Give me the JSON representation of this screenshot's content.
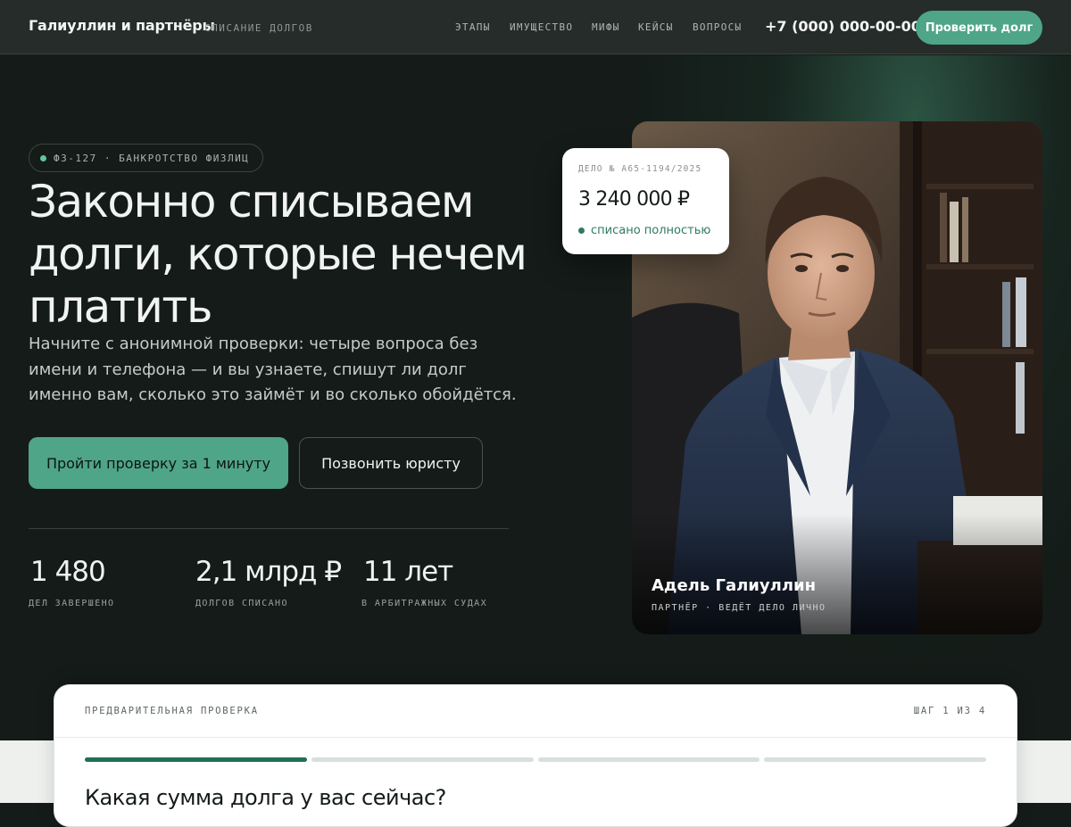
{
  "header": {
    "brand": "Галиуллин и партнёры",
    "tagline": "СПИСАНИЕ ДОЛГОВ",
    "nav": [
      "ЭТАПЫ",
      "ИМУЩЕСТВО",
      "МИФЫ",
      "КЕЙСЫ",
      "ВОПРОСЫ"
    ],
    "phone": "+7 (000) 000-00-00",
    "cta": "Проверить долг"
  },
  "hero": {
    "badge": "ФЗ-127 · БАНКРОТСТВО ФИЗЛИЦ",
    "title": "Законно списываем долги, которые нечем платить",
    "subtitle": "Начните с анонимной проверки: четыре вопроса без имени и телефона — и вы узнаете, спишут ли долг именно вам, сколько это займёт и во сколько обойдётся.",
    "primary_button": "Пройти проверку за 1 минуту",
    "secondary_button": "Позвонить юристу",
    "stats": [
      {
        "value": "1 480",
        "label": "ДЕЛ ЗАВЕРШЕНО"
      },
      {
        "value": "2,1 млрд ₽",
        "label": "ДОЛГОВ СПИСАНО"
      },
      {
        "value": "11 лет",
        "label": "В АРБИТРАЖНЫХ СУДАХ"
      }
    ]
  },
  "case_card": {
    "case_id": "ДЕЛО № А65-1194/2025",
    "amount": "3 240 000 ₽",
    "status": "списано полностью"
  },
  "person": {
    "name": "Адель Галиуллин",
    "role": "ПАРТНЁР · ВЕДЁТ ДЕЛО ЛИЧНО"
  },
  "check": {
    "title": "ПРЕДВАРИТЕЛЬНАЯ ПРОВЕРКА",
    "step": "ШАГ 1 ИЗ 4",
    "progress": {
      "current": 1,
      "total": 4
    },
    "question": "Какая сумма долга у вас сейчас?"
  },
  "colors": {
    "accent": "#4fa587",
    "accent_dark": "#226f55",
    "background": "#141b18",
    "header": "#252c29"
  }
}
